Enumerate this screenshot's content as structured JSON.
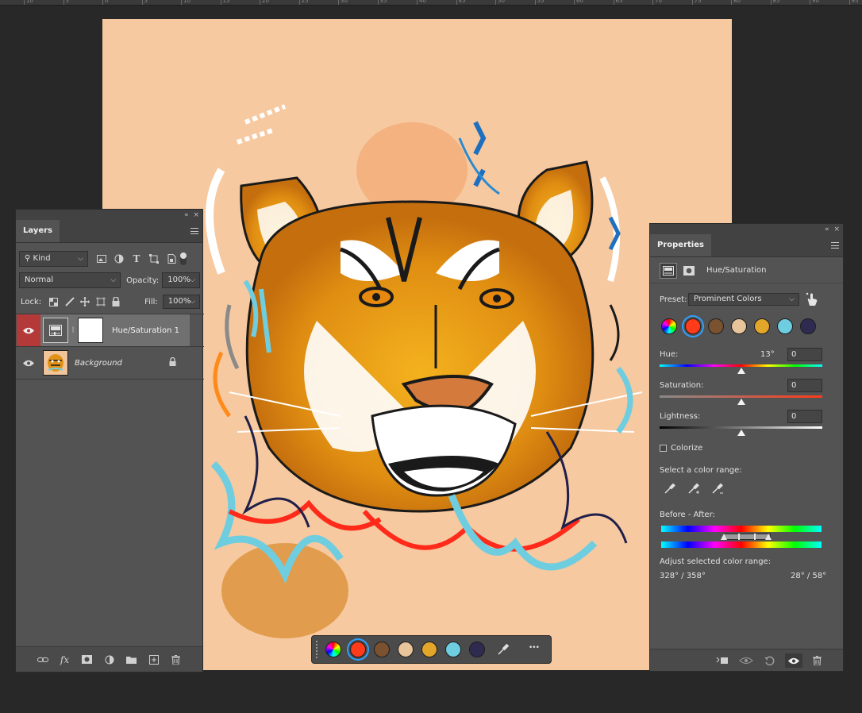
{
  "layers": {
    "tab": "Layers",
    "collapse_glyph": "«",
    "close_glyph": "×",
    "filter_kind": "Kind",
    "blend_mode": "Normal",
    "opacity_label": "Opacity:",
    "opacity_value": "100%",
    "lock_label": "Lock:",
    "fill_label": "Fill:",
    "fill_value": "100%",
    "items": [
      {
        "name": "Hue/Saturation 1",
        "selected": true
      },
      {
        "name": "Background",
        "selected": false
      }
    ]
  },
  "properties": {
    "tab": "Properties",
    "collapse_glyph": "«",
    "close_glyph": "×",
    "adjustment": "Hue/Saturation",
    "preset_label": "Preset:",
    "preset_value": "Prominent Colors",
    "swatches": [
      "#ff3b1a",
      "#ff3b1a",
      "#7a5230",
      "#e8c49a",
      "#e2a72a",
      "#6fcde0",
      "#2f2a50"
    ],
    "hue_label": "Hue:",
    "hue_degree": "13°",
    "hue_value": "0",
    "hue_level": 0.5,
    "saturation_label": "Saturation:",
    "saturation_value": "0",
    "saturation_level": 0.5,
    "lightness_label": "Lightness:",
    "lightness_value": "0",
    "lightness_level": 0.5,
    "colorize_label": "Colorize",
    "color_range_label": "Select a color range:",
    "before_after_label": "Before - After:",
    "adjust_label": "Adjust selected color range:",
    "range_left": "328° / 358°",
    "range_right": "28° / 58°"
  },
  "swatchbar": {
    "colors": [
      "#ff3b1a",
      "#7a5230",
      "#e8c49a",
      "#e2a72a",
      "#6fcde0",
      "#2f2a50"
    ],
    "more_glyph": "•••"
  },
  "ruler": {
    "labels": [
      "10",
      "5",
      "0",
      "5",
      "10",
      "15",
      "20",
      "25",
      "30",
      "35",
      "40",
      "45",
      "50",
      "55",
      "60",
      "65",
      "70",
      "75",
      "80",
      "85",
      "90",
      "95"
    ]
  }
}
